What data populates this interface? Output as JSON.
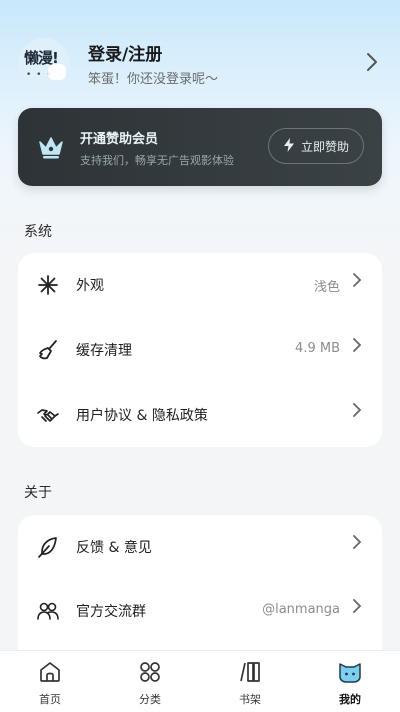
{
  "profile": {
    "avatar_text": "懒漫!",
    "title": "登录/注册",
    "subtitle": "笨蛋！你还没登录呢～"
  },
  "vip": {
    "title": "开通赞助会员",
    "subtitle": "支持我们，畅享无广告观影体验",
    "button_label": "立即赞助"
  },
  "system": {
    "heading": "系统",
    "items": [
      {
        "label": "外观",
        "value": "浅色",
        "icon": "appearance-icon"
      },
      {
        "label": "缓存清理",
        "value": "4.9 MB",
        "icon": "broom-icon"
      },
      {
        "label": "用户协议 & 隐私政策",
        "value": "",
        "icon": "handshake-icon"
      }
    ]
  },
  "about": {
    "heading": "关于",
    "items": [
      {
        "label": "反馈 & 意见",
        "value": "",
        "icon": "feather-icon"
      },
      {
        "label": "官方交流群",
        "value": "@lanmanga",
        "icon": "group-icon"
      }
    ]
  },
  "tabbar": {
    "items": [
      {
        "label": "首页",
        "icon": "home-icon"
      },
      {
        "label": "分类",
        "icon": "category-icon"
      },
      {
        "label": "书架",
        "icon": "bookshelf-icon"
      },
      {
        "label": "我的",
        "icon": "cat-icon",
        "active": true
      }
    ]
  },
  "colors": {
    "header_gradient_top": "#c9e8fb",
    "vip_bg": "#2d3336",
    "page_bg": "#f4f5f7"
  }
}
